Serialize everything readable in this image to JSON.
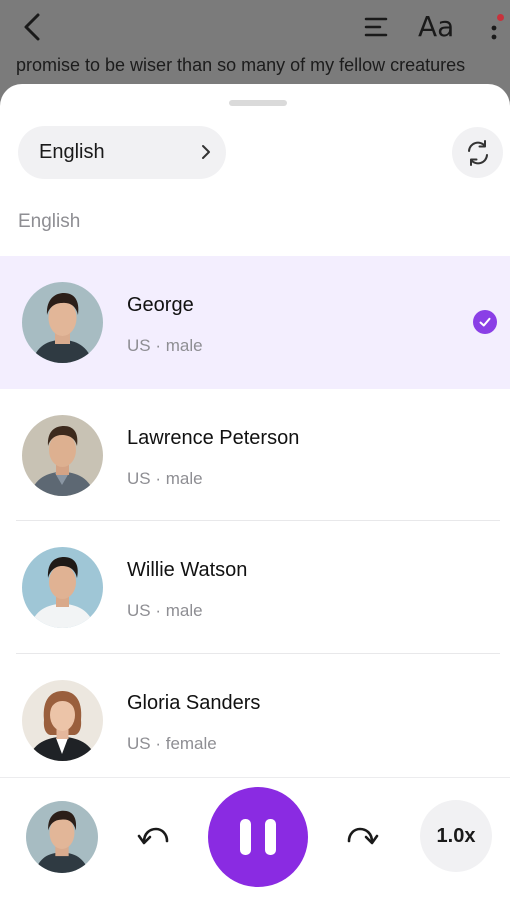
{
  "reader": {
    "text": "promise to be wiser than so many of my fellow creatures",
    "font_icon_label": "Aa",
    "icons": [
      "back-arrow-icon",
      "table-of-contents-icon",
      "font-size-icon",
      "more-vertical-icon"
    ]
  },
  "sheet": {
    "language_button_label": "English",
    "section_label": "English",
    "voices": [
      {
        "name": "George",
        "meta": "US · male",
        "selected": true
      },
      {
        "name": "Lawrence Peterson",
        "meta": "US · male",
        "selected": false
      },
      {
        "name": "Willie Watson",
        "meta": "US · male",
        "selected": false
      },
      {
        "name": "Gloria Sanders",
        "meta": "US · female",
        "selected": false
      }
    ]
  },
  "player": {
    "speed_label": "1.0x",
    "state": "playing"
  },
  "colors": {
    "accent": "#8a2be2",
    "selected_row": "#f3eefe",
    "notification_dot": "#c8323c"
  }
}
